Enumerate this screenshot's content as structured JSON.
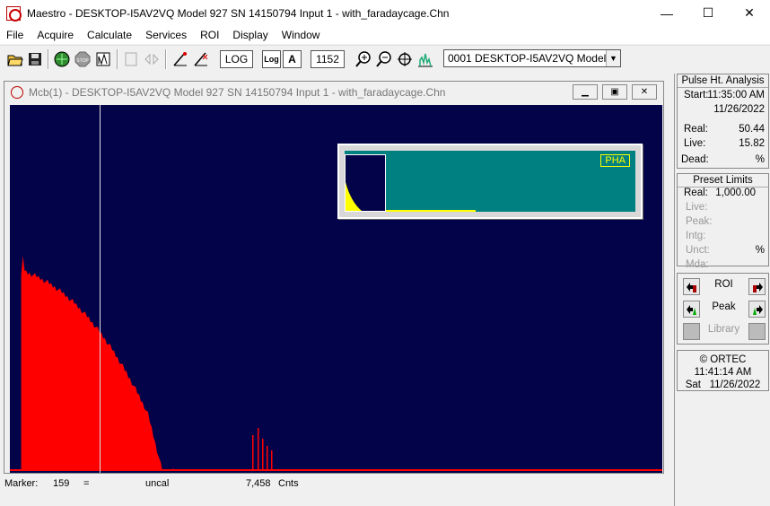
{
  "window": {
    "title": "Maestro - DESKTOP-I5AV2VQ Model 927 SN 14150794 Input 1 - with_faradaycage.Chn",
    "minimize": "—",
    "maximize": "☐",
    "close": "✕"
  },
  "menu": [
    "File",
    "Acquire",
    "Calculate",
    "Services",
    "ROI",
    "Display",
    "Window"
  ],
  "toolbar": {
    "log_label": "LOG",
    "log_toggle": "Log",
    "auto_label": "A",
    "vscale_value": "1152",
    "detector_value": "0001  DESKTOP-I5AV2VQ Model 92",
    "icons": [
      "open-icon",
      "save-icon",
      "start-icon",
      "stop-icon",
      "clear-icon",
      "copy-icon",
      "compare-icon",
      "roi-mark-icon",
      "roi-clear-icon",
      "zoom-in-icon",
      "zoom-out-icon",
      "center-icon",
      "fullview-icon"
    ]
  },
  "child": {
    "title": "Mcb(1) - DESKTOP-I5AV2VQ Model 927 SN 14150794 Input 1 - with_faradaycage.Chn",
    "pha_label": "PHA"
  },
  "status": {
    "marker_label": "Marker:",
    "marker_channel": "159",
    "equals": "=",
    "energy": "uncal",
    "counts": "7,458",
    "counts_unit": "Cnts"
  },
  "pulse": {
    "title": "Pulse Ht. Analysis",
    "start_label": "Start:",
    "start_time": "11:35:00 AM",
    "start_date": "11/26/2022",
    "real_label": "Real:",
    "real_value": "50.44",
    "live_label": "Live:",
    "live_value": "15.82",
    "dead_label": "Dead:",
    "dead_value": "%"
  },
  "preset": {
    "title": "Preset Limits",
    "real_label": "Real:",
    "real_value": "1,000.00",
    "live_label": "Live:",
    "peak_label": "Peak:",
    "intg_label": "Intg:",
    "unct_label": "Unct:",
    "unct_value": "%",
    "mda_label": "Mda:"
  },
  "nav": {
    "roi_label": "ROI",
    "peak_label": "Peak",
    "library_label": "Library"
  },
  "clock": {
    "brand": "© ORTEC",
    "time": "11:41:14 AM",
    "day": "Sat",
    "date": "11/26/2022"
  },
  "colors": {
    "plot_bg": "#03034a",
    "spectrum": "#ff0000",
    "pha_bg": "#008080",
    "pha_text": "#ffff00"
  },
  "chart_data": {
    "type": "area",
    "spectrum_start_channel": 20,
    "spectrum_peak_channel": 23,
    "spectrum_end_channel": 293,
    "marker_channel": 159
  }
}
